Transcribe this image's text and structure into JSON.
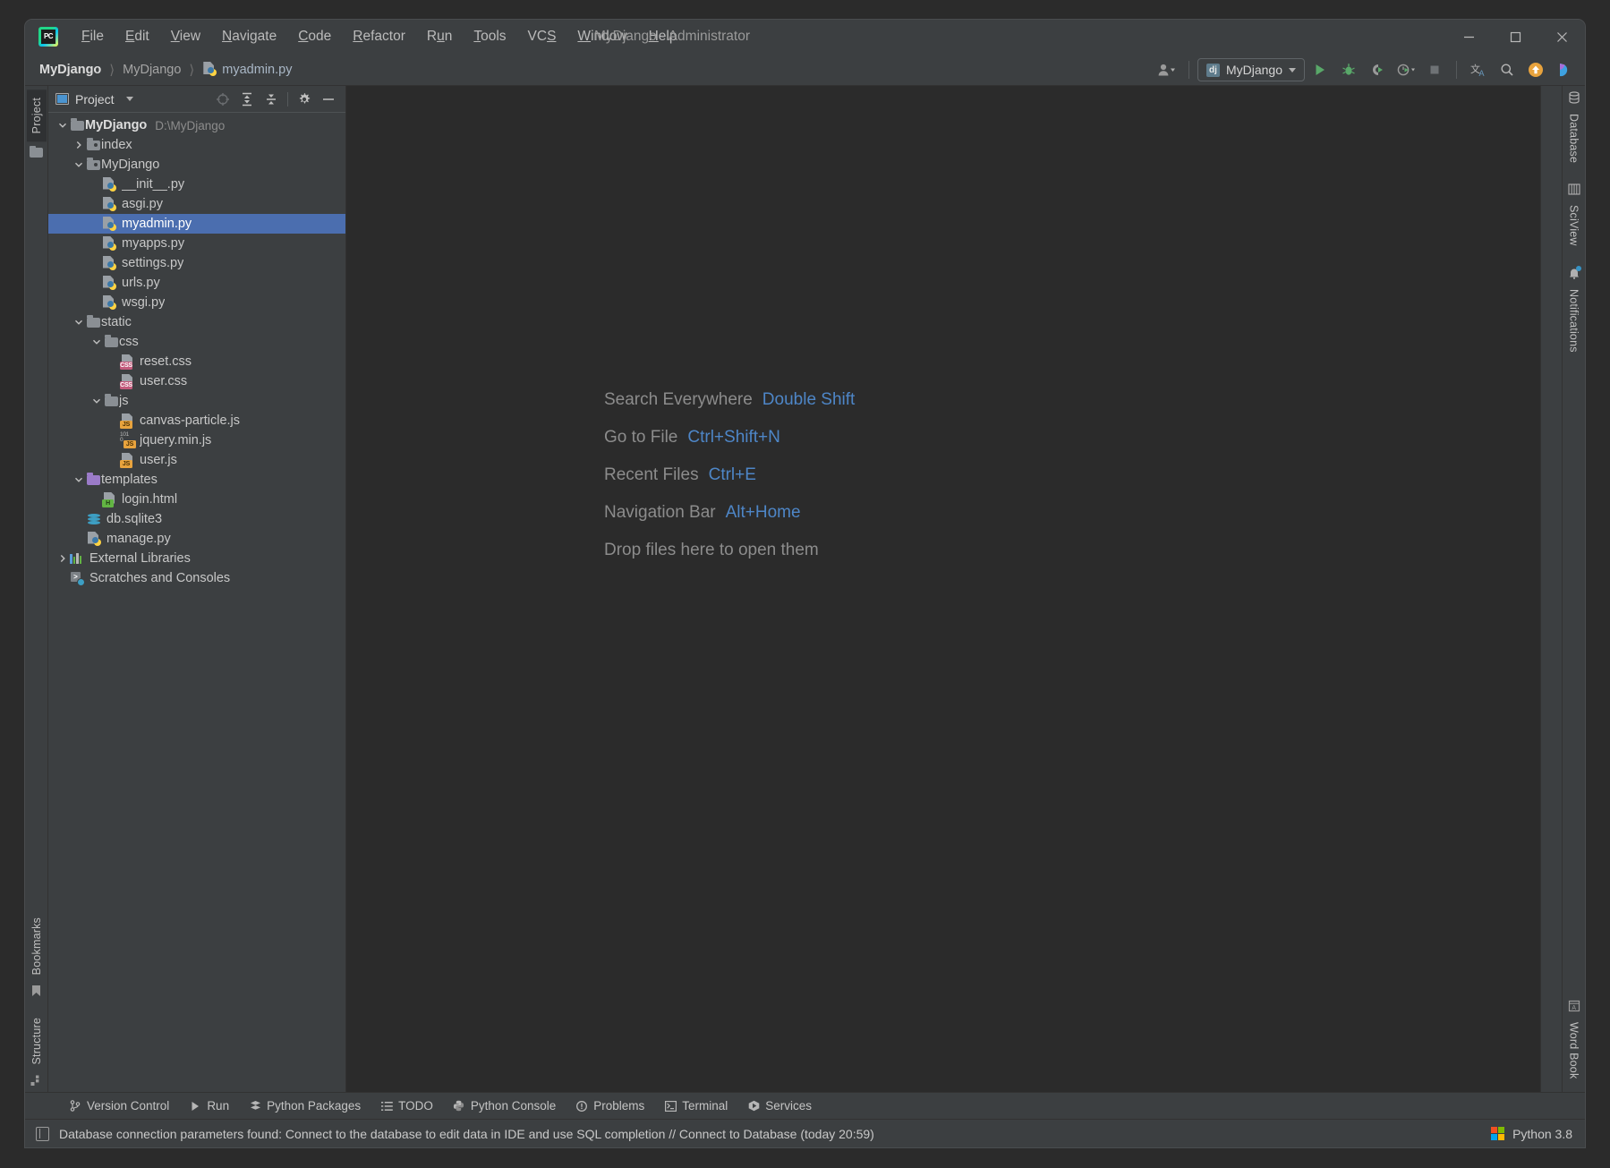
{
  "window": {
    "title": "MyDjango - Administrator",
    "logo_text": "PC",
    "controls": {
      "minimize": "minimize-icon",
      "maximize": "maximize-icon",
      "close": "close-icon"
    }
  },
  "menu": {
    "items": [
      {
        "label": "File",
        "mnemonic": "F"
      },
      {
        "label": "Edit",
        "mnemonic": "E"
      },
      {
        "label": "View",
        "mnemonic": "V"
      },
      {
        "label": "Navigate",
        "mnemonic": "N"
      },
      {
        "label": "Code",
        "mnemonic": "C"
      },
      {
        "label": "Refactor",
        "mnemonic": "R"
      },
      {
        "label": "Run",
        "mnemonic": "u"
      },
      {
        "label": "Tools",
        "mnemonic": "T"
      },
      {
        "label": "VCS",
        "mnemonic": "S"
      },
      {
        "label": "Window",
        "mnemonic": "W"
      },
      {
        "label": "Help",
        "mnemonic": "H"
      }
    ]
  },
  "breadcrumb": {
    "items": [
      {
        "label": "MyDjango",
        "style": "bold",
        "icon": ""
      },
      {
        "label": "MyDjango",
        "style": "dim",
        "icon": ""
      },
      {
        "label": "myadmin.py",
        "style": "normal",
        "icon": "python-file-icon"
      }
    ],
    "separator": "〉"
  },
  "toolbar": {
    "account_icon": "user-account-icon",
    "run_config": {
      "label": "MyDjango",
      "icon": "django-icon"
    },
    "run_label": "Run",
    "debug_label": "Debug",
    "run_coverage_label": "Run with Coverage",
    "profile_label": "Profile",
    "stop_label": "Stop",
    "translate_label": "Translate",
    "search_label": "Search",
    "update_label": "Update",
    "ide_label": "IDE Feature Trainer"
  },
  "project_panel": {
    "title": "Project",
    "actions": [
      {
        "name": "select-opened-file",
        "label": "Select Opened File"
      },
      {
        "name": "expand-all",
        "label": "Expand All"
      },
      {
        "name": "collapse-all",
        "label": "Collapse All"
      },
      {
        "name": "settings",
        "label": "Settings"
      },
      {
        "name": "hide",
        "label": "Hide"
      }
    ],
    "tree": [
      {
        "label": "MyDjango",
        "path": "D:\\MyDjango",
        "indent": 0,
        "arrow": "down",
        "icon": "folder",
        "bold": true,
        "selected": false
      },
      {
        "label": "index",
        "path": "",
        "indent": 1,
        "arrow": "right",
        "icon": "folder-module",
        "bold": false,
        "selected": false
      },
      {
        "label": "MyDjango",
        "path": "",
        "indent": 1,
        "arrow": "down",
        "icon": "folder-module",
        "bold": false,
        "selected": false
      },
      {
        "label": "__init__.py",
        "path": "",
        "indent": 2,
        "arrow": "none",
        "icon": "python",
        "bold": false,
        "selected": false
      },
      {
        "label": "asgi.py",
        "path": "",
        "indent": 2,
        "arrow": "none",
        "icon": "python",
        "bold": false,
        "selected": false
      },
      {
        "label": "myadmin.py",
        "path": "",
        "indent": 2,
        "arrow": "none",
        "icon": "python",
        "bold": false,
        "selected": true
      },
      {
        "label": "myapps.py",
        "path": "",
        "indent": 2,
        "arrow": "none",
        "icon": "python",
        "bold": false,
        "selected": false
      },
      {
        "label": "settings.py",
        "path": "",
        "indent": 2,
        "arrow": "none",
        "icon": "python",
        "bold": false,
        "selected": false
      },
      {
        "label": "urls.py",
        "path": "",
        "indent": 2,
        "arrow": "none",
        "icon": "python",
        "bold": false,
        "selected": false
      },
      {
        "label": "wsgi.py",
        "path": "",
        "indent": 2,
        "arrow": "none",
        "icon": "python",
        "bold": false,
        "selected": false
      },
      {
        "label": "static",
        "path": "",
        "indent": 1,
        "arrow": "down",
        "icon": "folder",
        "bold": false,
        "selected": false
      },
      {
        "label": "css",
        "path": "",
        "indent": 2,
        "arrow": "down",
        "icon": "folder",
        "bold": false,
        "selected": false
      },
      {
        "label": "reset.css",
        "path": "",
        "indent": 3,
        "arrow": "none",
        "icon": "css",
        "bold": false,
        "selected": false
      },
      {
        "label": "user.css",
        "path": "",
        "indent": 3,
        "arrow": "none",
        "icon": "css",
        "bold": false,
        "selected": false
      },
      {
        "label": "js",
        "path": "",
        "indent": 2,
        "arrow": "down",
        "icon": "folder",
        "bold": false,
        "selected": false
      },
      {
        "label": "canvas-particle.js",
        "path": "",
        "indent": 3,
        "arrow": "none",
        "icon": "js",
        "bold": false,
        "selected": false
      },
      {
        "label": "jquery.min.js",
        "path": "",
        "indent": 3,
        "arrow": "none",
        "icon": "js-min",
        "bold": false,
        "selected": false
      },
      {
        "label": "user.js",
        "path": "",
        "indent": 3,
        "arrow": "none",
        "icon": "js",
        "bold": false,
        "selected": false
      },
      {
        "label": "templates",
        "path": "",
        "indent": 1,
        "arrow": "down",
        "icon": "folder-purple",
        "bold": false,
        "selected": false
      },
      {
        "label": "login.html",
        "path": "",
        "indent": 2,
        "arrow": "none",
        "icon": "html",
        "bold": false,
        "selected": false
      },
      {
        "label": "db.sqlite3",
        "path": "",
        "indent": 1,
        "arrow": "none",
        "icon": "sqlite",
        "bold": false,
        "selected": false
      },
      {
        "label": "manage.py",
        "path": "",
        "indent": 1,
        "arrow": "none",
        "icon": "python",
        "bold": false,
        "selected": false
      },
      {
        "label": "External Libraries",
        "path": "",
        "indent": 0,
        "arrow": "right",
        "icon": "libraries",
        "bold": false,
        "selected": false
      },
      {
        "label": "Scratches and Consoles",
        "path": "",
        "indent": 0,
        "arrow": "none",
        "icon": "scratches",
        "bold": false,
        "selected": false
      }
    ]
  },
  "left_strip": {
    "top": [
      {
        "label": "Project",
        "icon": "folder-icon",
        "active": true
      }
    ],
    "bottom": [
      {
        "label": "Bookmarks",
        "icon": "bookmark-icon",
        "active": false
      },
      {
        "label": "Structure",
        "icon": "structure-icon",
        "active": false
      }
    ]
  },
  "right_strip": {
    "top": [
      {
        "label": "Database",
        "icon": "database-icon"
      },
      {
        "label": "SciView",
        "icon": "sciview-icon"
      },
      {
        "label": "Notifications",
        "icon": "bell-icon",
        "badge": true
      }
    ],
    "bottom": [
      {
        "label": "Word Book",
        "icon": "book-icon"
      }
    ]
  },
  "editor": {
    "hints": [
      {
        "label": "Search Everywhere",
        "key": "Double Shift"
      },
      {
        "label": "Go to File",
        "key": "Ctrl+Shift+N"
      },
      {
        "label": "Recent Files",
        "key": "Ctrl+E"
      },
      {
        "label": "Navigation Bar",
        "key": "Alt+Home"
      }
    ],
    "drop_hint": "Drop files here to open them"
  },
  "bottom_bar": {
    "tabs": [
      {
        "label": "Version Control",
        "icon": "branch-icon"
      },
      {
        "label": "Run",
        "icon": "play-icon"
      },
      {
        "label": "Python Packages",
        "icon": "packages-icon"
      },
      {
        "label": "TODO",
        "icon": "list-icon"
      },
      {
        "label": "Python Console",
        "icon": "python-icon"
      },
      {
        "label": "Problems",
        "icon": "warning-icon"
      },
      {
        "label": "Terminal",
        "icon": "terminal-icon"
      },
      {
        "label": "Services",
        "icon": "services-icon"
      }
    ]
  },
  "status_bar": {
    "message": "Database connection parameters found: Connect to the database to edit data in IDE and use SQL completion // Connect to Database (today 20:59)",
    "interpreter": "Python 3.8",
    "memory_icon": "document-icon",
    "platform_icon": "windows-icon"
  },
  "colors": {
    "selection": "#4b6eaf",
    "link": "#4e86c7",
    "panel_bg": "#3c3f41",
    "editor_bg": "#2b2b2b",
    "text": "#c8c8c8",
    "css_badge": "#c25b7c",
    "js_badge": "#e8a33d",
    "html_badge": "#62b543",
    "python_yellow": "#ffd343",
    "python_blue": "#3b78a8",
    "db_teal": "#3d9fc4",
    "folder_purple": "#9b7bc8",
    "run_green": "#59a869",
    "update_orange": "#e8a33d"
  }
}
